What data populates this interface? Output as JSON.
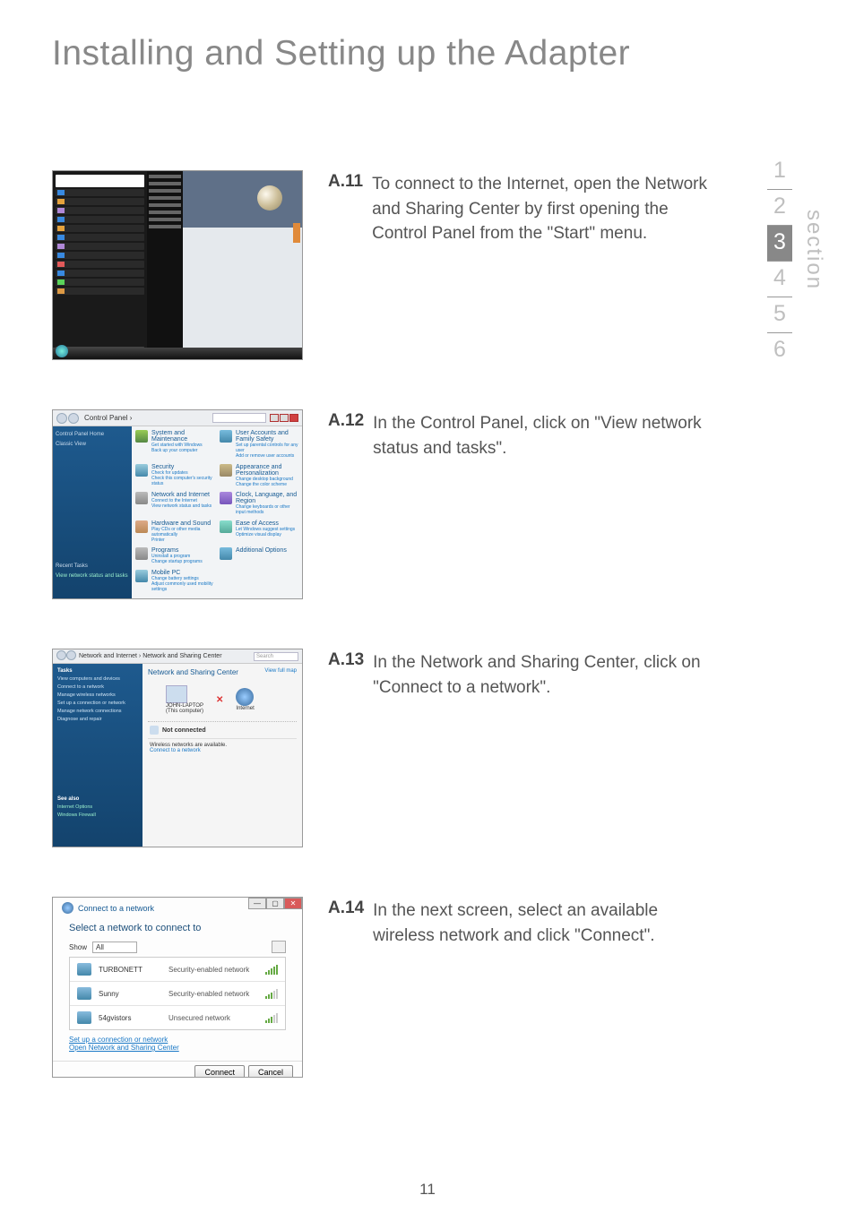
{
  "page_title": "Installing and Setting up the Adapter",
  "page_number": "11",
  "section_nav": {
    "items": [
      "1",
      "2",
      "3",
      "4",
      "5",
      "6"
    ],
    "active_index": 2,
    "label": "section"
  },
  "steps": {
    "a11": {
      "num": "A.11",
      "text": "To connect to the Internet, open the Network and Sharing Center by first opening the Control Panel from the \"Start\" menu."
    },
    "a12": {
      "num": "A.12",
      "text": "In the Control Panel, click on \"View network status and tasks\"."
    },
    "a13": {
      "num": "A.13",
      "text": "In the Network and Sharing Center, click on \"Connect to a network\"."
    },
    "a14": {
      "num": "A.14",
      "text": "In the next screen, select an available wireless network and click \"Connect\"."
    }
  },
  "control_panel": {
    "breadcrumb": "Control Panel  ›",
    "sidebar_1": "Control Panel Home",
    "sidebar_2": "Classic View",
    "sidebar_3": "Recent Tasks",
    "sidebar_4": "View network status and tasks",
    "categories": [
      {
        "title": "System and Maintenance",
        "sub1": "Get started with Windows",
        "sub2": "Back up your computer"
      },
      {
        "title": "User Accounts and Family Safety",
        "sub1": "Set up parental controls for any user",
        "sub2": "Add or remove user accounts"
      },
      {
        "title": "Security",
        "sub1": "Check for updates",
        "sub2": "Check this computer's security status"
      },
      {
        "title": "Appearance and Personalization",
        "sub1": "Change desktop background",
        "sub2": "Change the color scheme"
      },
      {
        "title": "Network and Internet",
        "sub1": "Connect to the Internet",
        "sub2": "View network status and tasks"
      },
      {
        "title": "Clock, Language, and Region",
        "sub1": "Change keyboards or other input methods",
        "sub2": ""
      },
      {
        "title": "Hardware and Sound",
        "sub1": "Play CDs or other media automatically",
        "sub2": "Printer"
      },
      {
        "title": "Ease of Access",
        "sub1": "Let Windows suggest settings",
        "sub2": "Optimize visual display"
      },
      {
        "title": "Programs",
        "sub1": "Uninstall a program",
        "sub2": "Change startup programs"
      },
      {
        "title": "Additional Options",
        "sub1": "",
        "sub2": ""
      },
      {
        "title": "Mobile PC",
        "sub1": "Change battery settings",
        "sub2": "Adjust commonly used mobility settings"
      }
    ]
  },
  "nsc": {
    "breadcrumb": "Network and Internet  ›  Network and Sharing Center",
    "search_placeholder": "Search",
    "side_header": "Tasks",
    "side_items": [
      "View computers and devices",
      "Connect to a network",
      "Manage wireless networks",
      "Set up a connection or network",
      "Manage network connections",
      "Diagnose and repair"
    ],
    "side_footer_header": "See also",
    "side_footer_items": [
      "Internet Options",
      "Windows Firewall"
    ],
    "main_header": "Network and Sharing Center",
    "view_map": "View full map",
    "pc_label": "JOHN-LAPTOP",
    "pc_sub": "(This computer)",
    "inet_label": "Internet",
    "not_connected": "Not connected",
    "avail_text": "Wireless networks are available.",
    "connect_link": "Connect to a network"
  },
  "connect": {
    "win_title": "Connect to a network",
    "header": "Select a network to connect to",
    "show_label": "Show",
    "show_value": "All",
    "networks": [
      {
        "name": "TURBONETT",
        "security": "Security-enabled network",
        "strength": "high"
      },
      {
        "name": "Sunny",
        "security": "Security-enabled network",
        "strength": "mid"
      },
      {
        "name": "54gvistors",
        "security": "Unsecured network",
        "strength": "mid"
      }
    ],
    "link1": "Set up a connection or network",
    "link2": "Open Network and Sharing Center",
    "btn_connect": "Connect",
    "btn_cancel": "Cancel"
  }
}
